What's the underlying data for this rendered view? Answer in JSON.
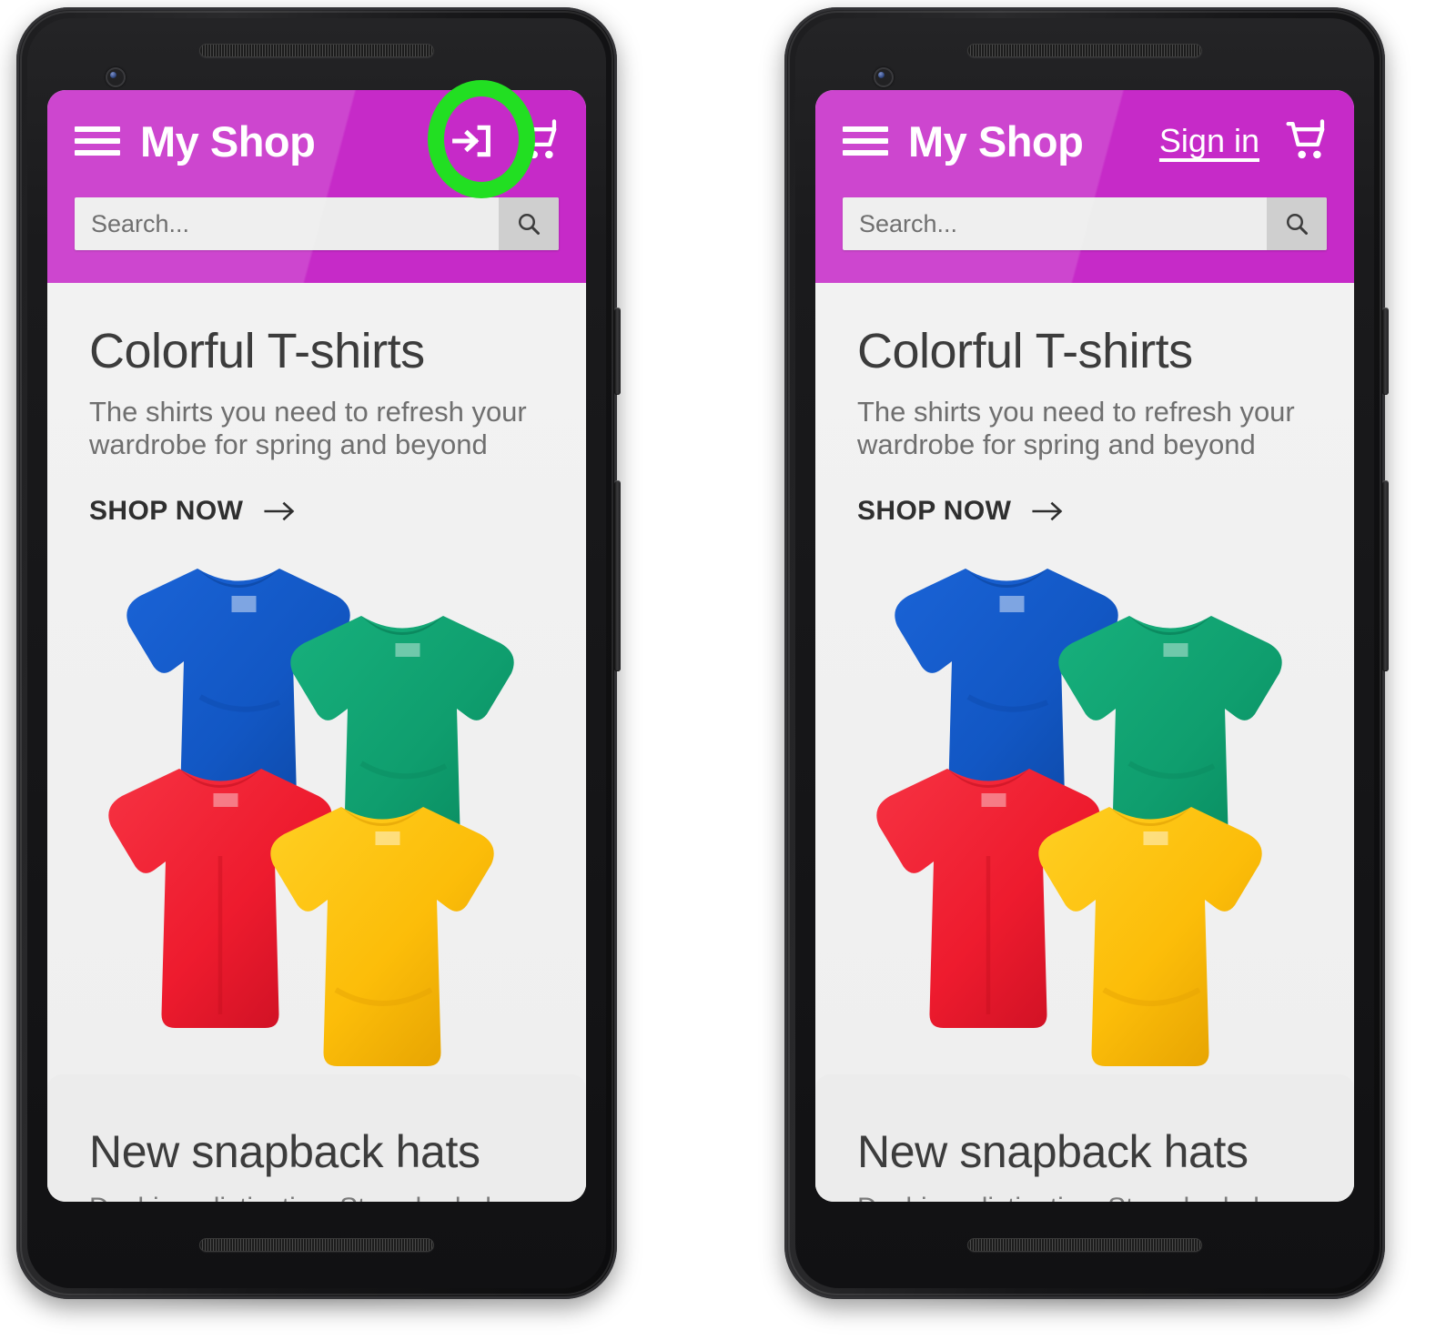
{
  "meta": {
    "accent_magenta": "#c62ac8",
    "annotation_green": "#22df22",
    "page_bg": "#efefef"
  },
  "phones": [
    {
      "id": "phone-left",
      "appbar": {
        "menu_icon": "hamburger-menu-icon",
        "brand": "My Shop",
        "account_control": {
          "type": "icon",
          "icon": "login-arrow-icon",
          "label": ""
        },
        "cart_icon": "shopping-cart-icon"
      },
      "search": {
        "value": "",
        "placeholder": "Search...",
        "button_icon": "search-magnifier-icon"
      },
      "hero": {
        "title": "Colorful T-shirts",
        "subtitle": "The shirts you need to refresh your wardrobe for spring and beyond",
        "cta_label": "SHOP NOW",
        "cta_icon": "arrow-right-icon",
        "image_alt": "four-tshirts-image"
      },
      "next_card": {
        "title": "New snapback hats",
        "subtitle": "Dashing, distinctive. Stay shaded on sunny"
      },
      "annotation": {
        "shape": "ellipse",
        "color": "#22df22",
        "targets": "login-arrow-icon"
      }
    },
    {
      "id": "phone-right",
      "appbar": {
        "menu_icon": "hamburger-menu-icon",
        "brand": "My Shop",
        "account_control": {
          "type": "link",
          "icon": "",
          "label": "Sign in"
        },
        "cart_icon": "shopping-cart-icon"
      },
      "search": {
        "value": "",
        "placeholder": "Search...",
        "button_icon": "search-magnifier-icon"
      },
      "hero": {
        "title": "Colorful T-shirts",
        "subtitle": "The shirts you need to refresh your wardrobe for spring and beyond",
        "cta_label": "SHOP NOW",
        "cta_icon": "arrow-right-icon",
        "image_alt": "four-tshirts-image"
      },
      "next_card": {
        "title": "New snapback hats",
        "subtitle": "Dashing, distinctive. Stay shaded on sunny"
      },
      "annotation": {
        "shape": "ellipse",
        "color": "#22df22",
        "targets": "sign-in-link"
      }
    }
  ],
  "shirt_colors": {
    "blue": "#1257c4",
    "green": "#0f9e6e",
    "red": "#ee1b2e",
    "yellow": "#fcbd09"
  }
}
